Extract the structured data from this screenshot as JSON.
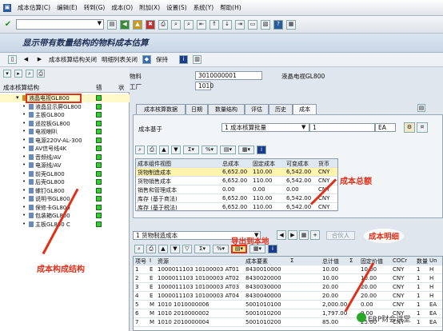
{
  "menu": [
    "成本估算(C)",
    "编辑(E)",
    "转到(G)",
    "成本(O)",
    "附加(X)",
    "设置(S)",
    "系统(Y)",
    "帮助(H)"
  ],
  "title": "显示带有数量结构的物料成本估算",
  "appbar": {
    "costing_structure_close": "成本核算结构关闭",
    "detail_list_close": "明细列表关闭",
    "keep": "保持"
  },
  "tree": {
    "header": "成本核算结构",
    "col_err": "错",
    "col_status": "状",
    "items": [
      "液晶电视GL800",
      "液晶显示屏GL800",
      "主板GL800",
      "遥控板GL800",
      "电视喇叭",
      "电源220V-AL-300",
      "AV信号线4K",
      "音频线/AV",
      "电源线/AV",
      "前壳GL800",
      "后壳GL800",
      "螺钉GL800",
      "说明书GL800",
      "保修卡GL800",
      "包装箱GL800",
      "主板GL800 C"
    ]
  },
  "header": {
    "material_label": "物料",
    "material_value": "3010000001",
    "material_desc": "液晶电视GL800",
    "plant_label": "工厂",
    "plant_value": "1010"
  },
  "tabs": [
    "成本核算数据",
    "日期",
    "数量结构",
    "评估",
    "历史",
    "成本"
  ],
  "panel": {
    "basis_label": "成本基于",
    "basis_value": "1 成本核算批量",
    "qty": "1",
    "unit": "EA",
    "summary_headers": [
      "成本组件视图",
      "总成本",
      "固定成本",
      "可变成本",
      "货币"
    ],
    "summary_rows": [
      [
        "货物制造成本",
        "6,652.00",
        "110.00",
        "6,542.00",
        "CNY"
      ],
      [
        "货物销售成本",
        "6,652.00",
        "110.00",
        "6,542.00",
        "CNY"
      ],
      [
        "销售和管理成本",
        "0.00",
        "0.00",
        "0.00",
        "CNY"
      ],
      [
        "库存 (基于商法)",
        "6,652.00",
        "110.00",
        "6,542.00",
        "CNY"
      ],
      [
        "库存 (基于税法)",
        "6,652.00",
        "110.00",
        "6,542.00",
        "CNY"
      ]
    ]
  },
  "lower": {
    "dropdown": "1 货物制造成本",
    "partner_btn": "合伙人",
    "headers": [
      "项号",
      "I",
      "资源",
      "成本要素",
      "Σ",
      "总计值",
      "Σ",
      "固定价值",
      "COCr",
      "数量",
      "Un"
    ],
    "rows": [
      [
        "1",
        "E",
        "1000011103 10100003 AT01",
        "8430010000",
        "",
        "10.00",
        "",
        "10.00",
        "CNY",
        "1",
        "H"
      ],
      [
        "2",
        "E",
        "1000011103 10100003 AT02",
        "8430020000",
        "",
        "10.00",
        "",
        "10.00",
        "CNY",
        "1",
        "H"
      ],
      [
        "3",
        "E",
        "1000011103 10100003 AT03",
        "8430030000",
        "",
        "20.00",
        "",
        "20.00",
        "CNY",
        "1",
        "H"
      ],
      [
        "4",
        "E",
        "1000011103 10100003 AT04",
        "8430040000",
        "",
        "20.00",
        "",
        "20.00",
        "CNY",
        "1",
        "H"
      ],
      [
        "5",
        "M",
        "1010 1010000006",
        "5001010100",
        "",
        "2,000.00",
        "",
        "0.00",
        "CNY",
        "1",
        "EA"
      ],
      [
        "6",
        "M",
        "1010 2010000002",
        "5001010200",
        "",
        "1,797.00",
        "",
        "0.00",
        "CNY",
        "1",
        "EA"
      ],
      [
        "7",
        "M",
        "1010 2010000004",
        "5001010200",
        "",
        "85.00",
        "",
        "25.00",
        "CNY",
        "1",
        "EA"
      ]
    ]
  },
  "annotations": {
    "cost_structure": "成本构成结构",
    "cost_total": "成本总额",
    "export_local": "导出到本地",
    "cost_detail": "成本明细",
    "watermark": "ERP财会讲堂"
  },
  "colors": {
    "accent_red": "#e0301a",
    "status_green": "#33cc33",
    "title_blue": "#1f2f55"
  }
}
